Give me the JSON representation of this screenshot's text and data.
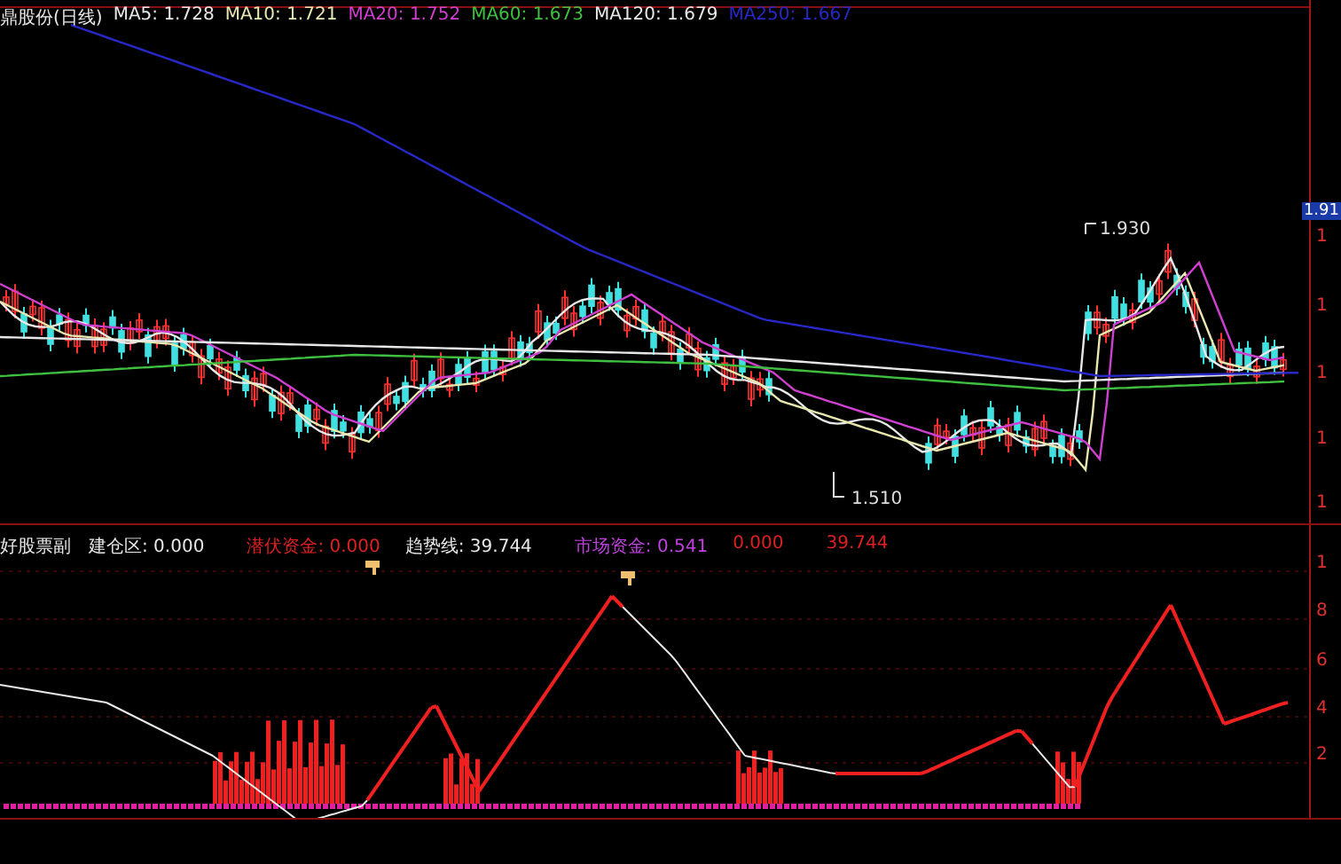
{
  "price_pane": {
    "legend": [
      {
        "text": "鼎股份(日线)",
        "color": "#e8e8e8"
      },
      {
        "text": "MA5: 1.728",
        "color": "#e8e8e8"
      },
      {
        "text": "MA10: 1.721",
        "color": "#e8e8b0"
      },
      {
        "text": "MA20: 1.752",
        "color": "#d040d0"
      },
      {
        "text": "MA60: 1.673",
        "color": "#40c040"
      },
      {
        "text": "MA120: 1.679",
        "color": "#e8e8e8"
      },
      {
        "text": "MA250: 1.667",
        "color": "#2828c8"
      }
    ],
    "annotations": [
      {
        "text": "1.930"
      },
      {
        "text": "1.510"
      }
    ],
    "axis": {
      "current": "1.91",
      "labels": [
        "1",
        "1",
        "1",
        "1",
        "1"
      ]
    }
  },
  "indicator_pane": {
    "legend": [
      {
        "text": "好股票副",
        "color": "#e8e8e8"
      },
      {
        "text": "建仓区: 0.000",
        "color": "#e8e8e8"
      },
      {
        "text": "潜伏资金: 0.000",
        "color": "#e02020"
      },
      {
        "text": "趋势线: 39.744",
        "color": "#e8e8e8"
      },
      {
        "text": "市场资金: 0.541",
        "color": "#c040e0"
      },
      {
        "text": "0.000",
        "color": "#e02020"
      },
      {
        "text": "39.744",
        "color": "#e02020"
      }
    ],
    "axis": {
      "labels": [
        "1",
        "8",
        "6",
        "4",
        "2"
      ]
    }
  }
}
